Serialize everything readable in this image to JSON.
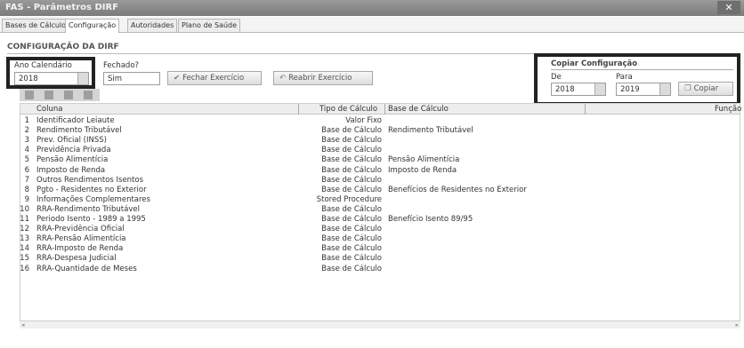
{
  "window": {
    "title": "FAS - Parâmetros DIRF",
    "close_glyph": "✕"
  },
  "tabs": [
    {
      "label": "Bases de Cálculo"
    },
    {
      "label": "Configuração"
    },
    {
      "label": "Autoridades"
    },
    {
      "label": "Plano de Saúde"
    }
  ],
  "section_title": "CONFIGURAÇÃO DA DIRF",
  "form": {
    "ano_label": "Ano Calendário",
    "ano_value": "2018",
    "fechado_label": "Fechado?",
    "fechado_value": "Sim",
    "fechar_button": "Fechar Exercício",
    "reabrir_button": "Reabrir Exercício"
  },
  "copiar": {
    "title": "Copiar Configuração",
    "de_label": "De",
    "de_value": "2018",
    "para_label": "Para",
    "para_value": "2019",
    "button": "Copiar"
  },
  "grid": {
    "headers": {
      "coluna": "Coluna",
      "tipo": "Tipo de Cálculo",
      "base": "Base de Cálculo",
      "funcao": "Função"
    },
    "rows": [
      {
        "num": "1",
        "coluna": "Identificador Leiaute",
        "tipo": "Valor Fixo",
        "base": ""
      },
      {
        "num": "2",
        "coluna": "Rendimento Tributável",
        "tipo": "Base de Cálculo",
        "base": "Rendimento Tributável"
      },
      {
        "num": "3",
        "coluna": "Prev. Oficial (INSS)",
        "tipo": "Base de Cálculo",
        "base": ""
      },
      {
        "num": "4",
        "coluna": "Previdência Privada",
        "tipo": "Base de Cálculo",
        "base": ""
      },
      {
        "num": "5",
        "coluna": "Pensão Alimentícia",
        "tipo": "Base de Cálculo",
        "base": "Pensão Alimentícia"
      },
      {
        "num": "6",
        "coluna": "Imposto de Renda",
        "tipo": "Base de Cálculo",
        "base": "Imposto de Renda"
      },
      {
        "num": "7",
        "coluna": "Outros Rendimentos Isentos",
        "tipo": "Base de Cálculo",
        "base": ""
      },
      {
        "num": "8",
        "coluna": "Pgto - Residentes no Exterior",
        "tipo": "Base de Cálculo",
        "base": "Benefícios de Residentes no Exterior"
      },
      {
        "num": "9",
        "coluna": "Informações Complementares",
        "tipo": "Stored Procedure",
        "base": ""
      },
      {
        "num": "10",
        "coluna": "RRA-Rendimento Tributável",
        "tipo": "Base de Cálculo",
        "base": ""
      },
      {
        "num": "11",
        "coluna": "Periodo Isento - 1989 a 1995",
        "tipo": "Base de Cálculo",
        "base": "Benefício Isento 89/95"
      },
      {
        "num": "12",
        "coluna": "RRA-Previdência Oficial",
        "tipo": "Base de Cálculo",
        "base": ""
      },
      {
        "num": "13",
        "coluna": "RRA-Pensão Alimentícia",
        "tipo": "Base de Cálculo",
        "base": ""
      },
      {
        "num": "14",
        "coluna": "RRA-Imposto de Renda",
        "tipo": "Base de Cálculo",
        "base": ""
      },
      {
        "num": "15",
        "coluna": "RRA-Despesa Judicial",
        "tipo": "Base de Cálculo",
        "base": ""
      },
      {
        "num": "16",
        "coluna": "RRA-Quantidade de Meses",
        "tipo": "Base de Cálculo",
        "base": ""
      }
    ]
  },
  "colors": {
    "titlebar": "#8a8a8a",
    "highlight": "#222222"
  },
  "icons": {
    "fechar": "check-icon",
    "reabrir": "undo-icon",
    "copiar": "copy-icon"
  }
}
